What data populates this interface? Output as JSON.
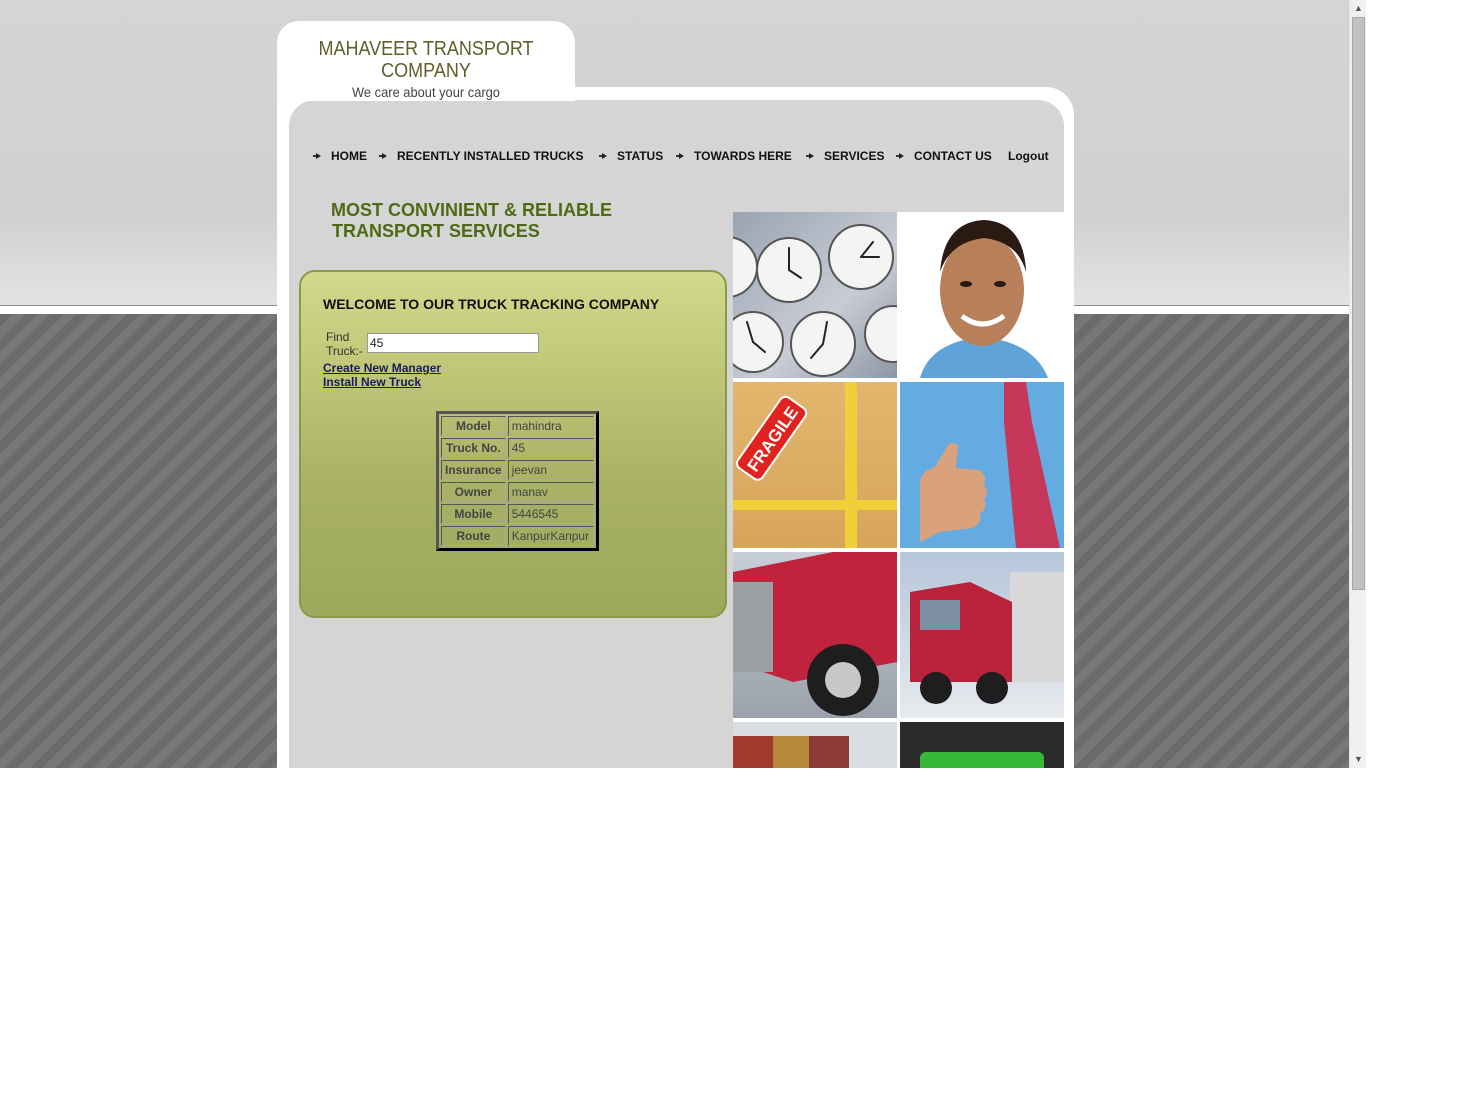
{
  "logo": {
    "name_line1": "MAHAVEER TRANSPORT",
    "name_line2": "COMPANY",
    "tagline": "We care about your cargo"
  },
  "nav": {
    "items": [
      {
        "label": "HOME",
        "bullet": true
      },
      {
        "label": "RECENTLY INSTALLED TRUCKS",
        "bullet": true
      },
      {
        "label": "STATUS",
        "bullet": true
      },
      {
        "label": "TOWARDS HERE",
        "bullet": true
      },
      {
        "label": "SERVICES",
        "bullet": true
      },
      {
        "label": "CONTACT US",
        "bullet": true
      },
      {
        "label": "Logout",
        "bullet": false
      }
    ]
  },
  "headline": {
    "line1": "MOST CONVINIENT & RELIABLE",
    "line2": "TRANSPORT SERVICES"
  },
  "welcome": {
    "title": "WELCOME TO OUR TRUCK TRACKING COMPANY",
    "find_label_line1": "Find",
    "find_label_line2": "Truck:-",
    "find_value": "45",
    "create_manager_link": "Create New Manager",
    "install_truck_link": "Install New Truck"
  },
  "truck_details": [
    {
      "key": "Model",
      "value": "mahindra"
    },
    {
      "key": "Truck No.",
      "value": "45"
    },
    {
      "key": "Insurance",
      "value": "jeevan"
    },
    {
      "key": "Owner",
      "value": "manav"
    },
    {
      "key": "Mobile",
      "value": "5446545"
    },
    {
      "key": "Route",
      "value": "KanpurKanpur"
    }
  ],
  "photos": [
    {
      "name": "clocks-photo",
      "icon": "wall-clocks"
    },
    {
      "name": "smiling-man-photo",
      "icon": "smiling-man"
    },
    {
      "name": "fragile-box-photo",
      "icon": "fragile-box",
      "sticker_text": "FRAGILE"
    },
    {
      "name": "thumbs-up-photo",
      "icon": "thumbs-up-man"
    },
    {
      "name": "red-truck-front-photo",
      "icon": "red-truck"
    },
    {
      "name": "red-truck-side-photo",
      "icon": "red-truck"
    },
    {
      "name": "containers-photo",
      "icon": "shipping-containers"
    },
    {
      "name": "keyboard-photo",
      "icon": "keyboard-key"
    }
  ],
  "colors": {
    "page_bg_top": "#d5d5d5",
    "page_bg_bottom": "#6e6e6e",
    "headline": "#4e6a12",
    "panel_top": "#d3d98c",
    "panel_bottom": "#9da85c",
    "logo_text": "#5f5f2a"
  }
}
